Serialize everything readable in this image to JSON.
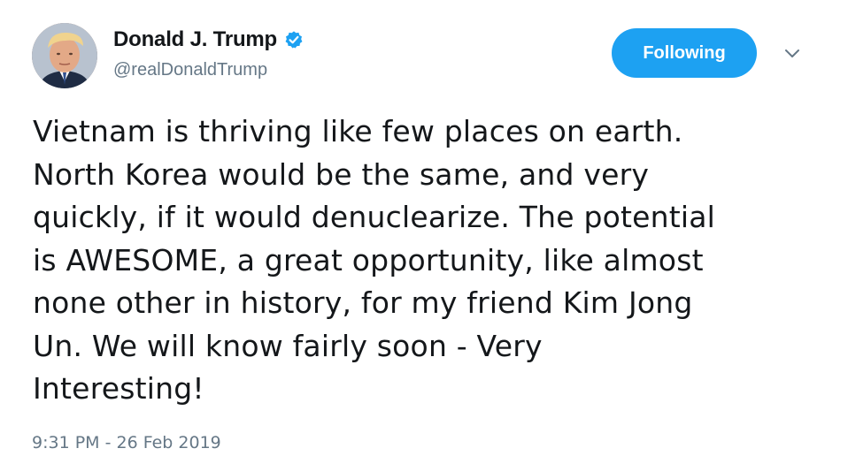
{
  "user": {
    "display_name": "Donald J. Trump",
    "handle": "@realDonaldTrump",
    "verified": true
  },
  "follow_button": {
    "label": "Following"
  },
  "icons": {
    "verified": "verified-badge-icon",
    "menu": "chevron-down-icon",
    "avatar": "profile-avatar"
  },
  "tweet": {
    "lines": [
      "Vietnam is thriving like few places on earth.",
      "North Korea would be the same, and very",
      "quickly, if it would denuclearize. The potential",
      "is AWESOME, a great opportunity, like almost",
      "none other in history, for my friend Kim Jong",
      "Un. We will know fairly soon - Very",
      "Interesting!"
    ],
    "timestamp": "9:31 PM - 26 Feb 2019"
  },
  "colors": {
    "accent": "#1da1f2",
    "text": "#14171a",
    "secondary": "#657786"
  }
}
